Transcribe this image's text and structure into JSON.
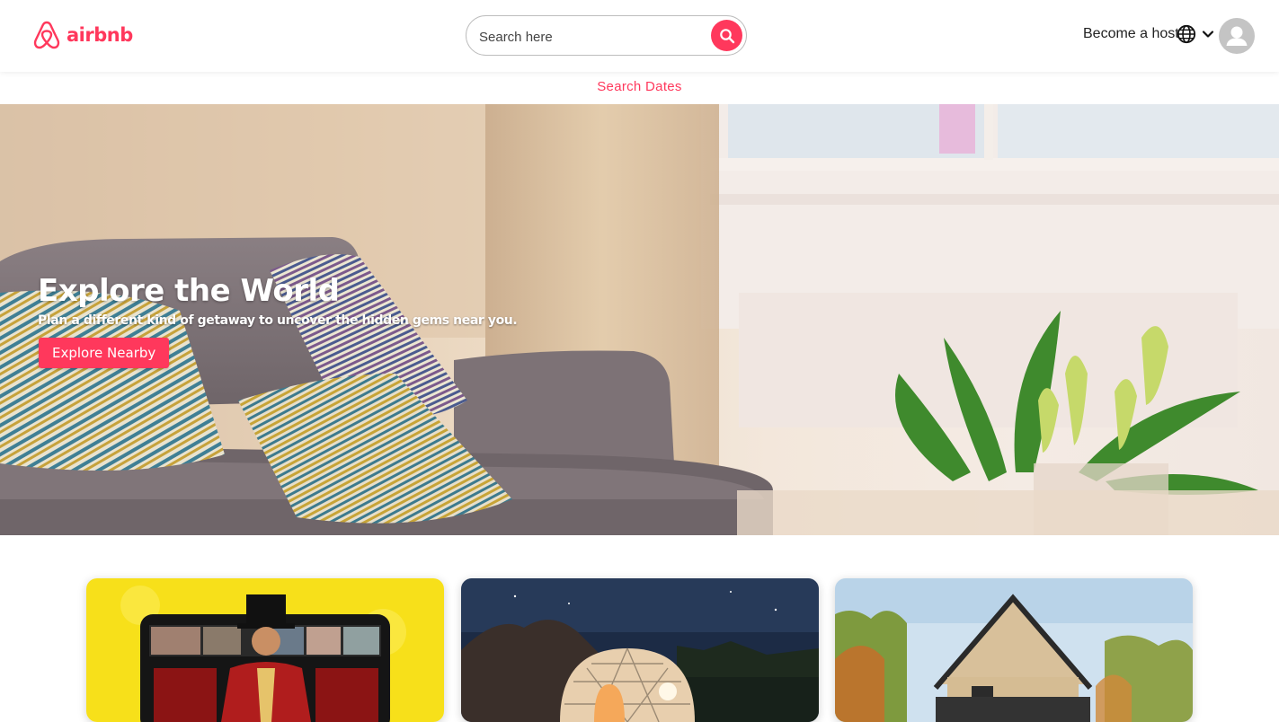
{
  "header": {
    "logo_text": "airbnb",
    "search_placeholder": "Search here",
    "become_host_label": "Become a host"
  },
  "search_dates_label": "Search Dates",
  "hero": {
    "title": "Explore the World",
    "subtitle": "Plan a different kind of getaway to uncover the hidden gems near you.",
    "button_label": "Explore Nearby"
  },
  "colors": {
    "brand": "#ff385c",
    "header_bg": "#ffffff",
    "avatar_bg": "#c4c4c4"
  },
  "icons": {
    "logo": "airbnb-belo-icon",
    "search": "search-icon",
    "globe": "globe-icon",
    "chevron": "chevron-down-icon",
    "avatar": "user-avatar-icon"
  }
}
